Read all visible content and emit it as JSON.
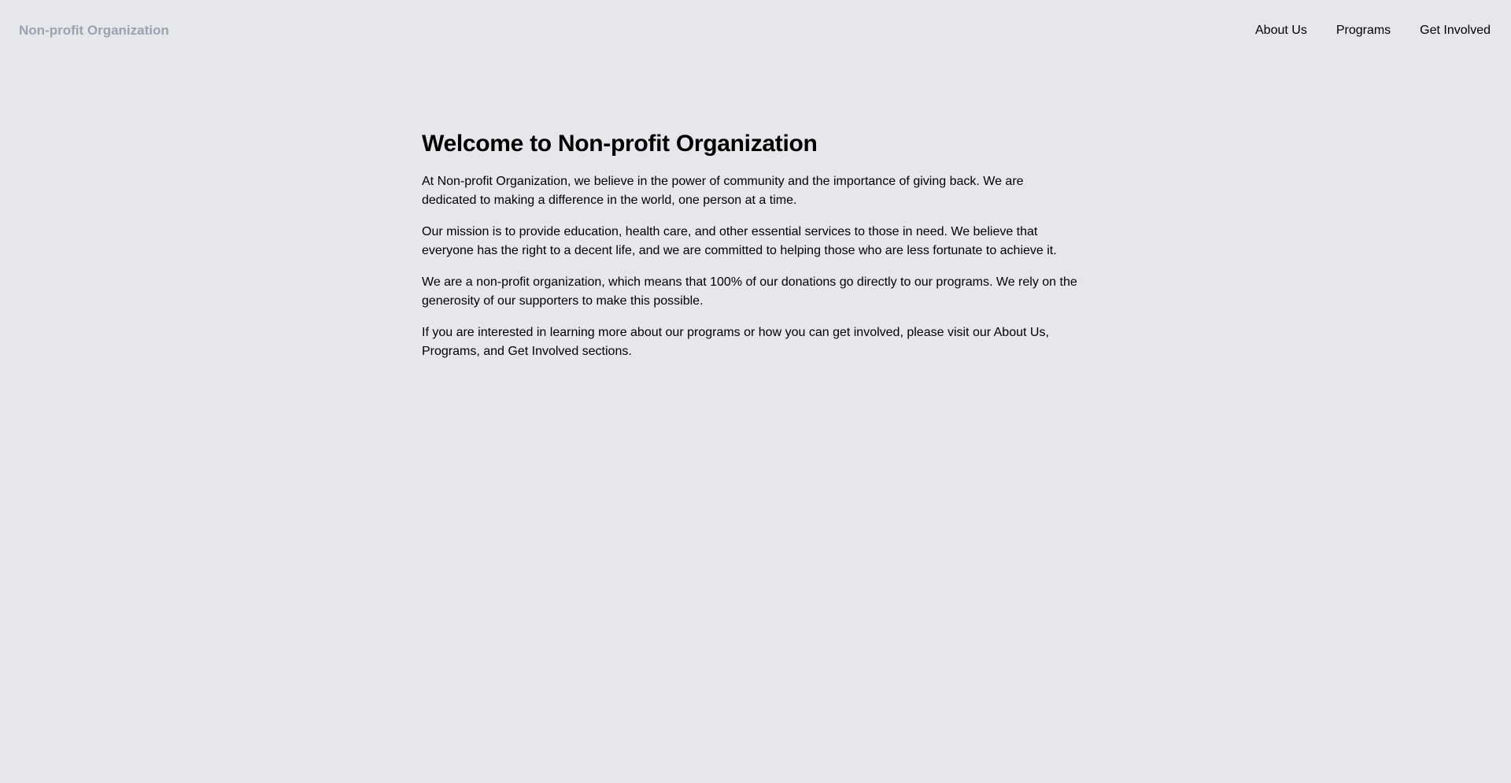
{
  "header": {
    "brand": "Non-profit Organization",
    "nav": [
      {
        "label": "About Us"
      },
      {
        "label": "Programs"
      },
      {
        "label": "Get Involved"
      }
    ]
  },
  "main": {
    "title": "Welcome to Non-profit Organization",
    "paragraphs": [
      "At Non-profit Organization, we believe in the power of community and the importance of giving back. We are dedicated to making a difference in the world, one person at a time.",
      "Our mission is to provide education, health care, and other essential services to those in need. We believe that everyone has the right to a decent life, and we are committed to helping those who are less fortunate to achieve it.",
      "We are a non-profit organization, which means that 100% of our donations go directly to our programs. We rely on the generosity of our supporters to make this possible.",
      "If you are interested in learning more about our programs or how you can get involved, please visit our About Us, Programs, and Get Involved sections."
    ]
  },
  "colors": {
    "background": "#e5e7eb",
    "brand": "#9ca3af",
    "text": "#000000"
  }
}
